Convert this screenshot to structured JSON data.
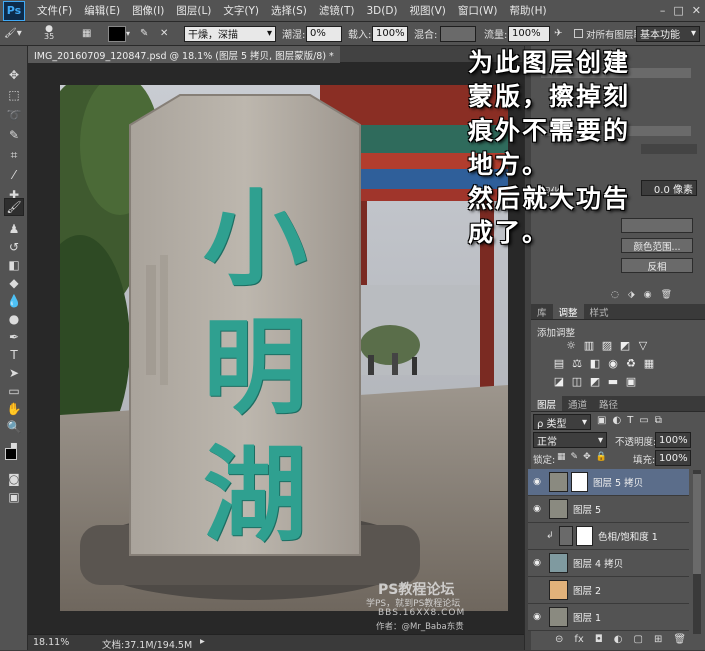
{
  "app": {
    "logo": "Ps"
  },
  "menu": [
    "文件(F)",
    "编辑(E)",
    "图像(I)",
    "图层(L)",
    "文字(Y)",
    "选择(S)",
    "滤镜(T)",
    "3D(D)",
    "视图(V)",
    "窗口(W)",
    "帮助(H)"
  ],
  "options": {
    "brush_size": "35",
    "mode": "干燥，深描",
    "wet_label": "潮湿:",
    "wet_value": "0%",
    "load_label": "载入:",
    "load_value": "100%",
    "mix_label": "混合:",
    "flow_label": "流量:",
    "flow_value": "100%",
    "sample_all": "对所有图层取样",
    "workspace": "基本功能"
  },
  "document": {
    "tab": "IMG_20160709_120847.psd @ 18.1% (图层 5 拷贝, 图层蒙版/8) *",
    "close": "×"
  },
  "stone_text": [
    "小",
    "明",
    "湖"
  ],
  "status": {
    "zoom": "18.11%",
    "doc": "文档:37.1M/194.5M"
  },
  "annotation": [
    "为此图层创建",
    "蒙版，擦掉刻",
    "痕外不需要的",
    "地方。",
    "然后就大功告",
    "成了。"
  ],
  "properties": {
    "feather_label": "羽化:",
    "feather_value": "0.0 像素",
    "btn_color_range": "颜色范围...",
    "btn_invert": "反相"
  },
  "adjust_tabs": [
    "库",
    "调整",
    "样式"
  ],
  "adjust_title": "添加调整",
  "layers_tabs": [
    "图层",
    "通道",
    "路径"
  ],
  "layers": {
    "filter": "ρ 类型",
    "blend_mode": "正常",
    "opacity_label": "不透明度:",
    "opacity_value": "100%",
    "lock_label": "锁定:",
    "fill_label": "填充:",
    "fill_value": "100%",
    "items": [
      {
        "name": "图层 5 拷贝",
        "selected": true
      },
      {
        "name": "图层 5",
        "selected": false
      },
      {
        "name": "色相/饱和度 1",
        "selected": false
      },
      {
        "name": "图层 4 拷贝",
        "selected": false
      },
      {
        "name": "图层 2",
        "selected": false
      },
      {
        "name": "图层 1",
        "selected": false
      }
    ]
  },
  "watermark": {
    "line1": "PS教程论坛",
    "line2": "学PS，就到PS教程论坛",
    "line3": "BBS.16XX8.COM",
    "line4": "作者：@Mr_Baba东贵"
  },
  "colors": {
    "accent": "#5b6d8a",
    "stone_ink": "#2fa090"
  }
}
